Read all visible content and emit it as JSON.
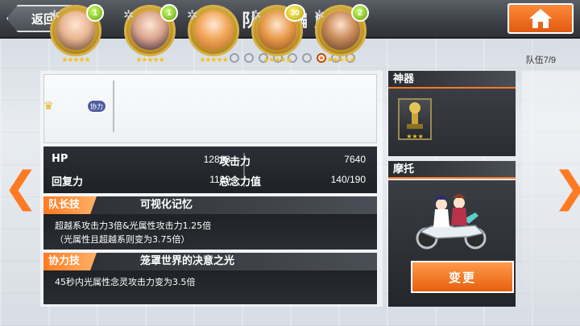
{
  "header": {
    "back_label": "返回",
    "title": "队伍编成"
  },
  "pager": {
    "team_count": "队伍7/9",
    "dots": 9,
    "active_index": 7
  },
  "characters": [
    {
      "level": "1",
      "stars": "★★★★★"
    },
    {
      "level": "1",
      "stars": "★★★★★"
    },
    {
      "level": "",
      "stars": "★★★★★"
    },
    {
      "level": "30",
      "stars": "★★★★★"
    },
    {
      "level": "2",
      "stars": "★★★★★"
    }
  ],
  "assist_tag": "协力",
  "stats": {
    "hp_label": "HP",
    "hp_value": "12828",
    "attack_label": "攻击力",
    "attack_value": "7640",
    "recovery_label": "回复力",
    "recovery_value": "1189",
    "total_label": "总念力值",
    "total_value": "140/190"
  },
  "leader_skill": {
    "tag": "队长技",
    "name": "可视化记忆",
    "line1": "超越系攻击力3倍&光属性攻击力1.25倍",
    "line2": "（光属性且超越系则变为3.75倍）"
  },
  "assist_skill": {
    "tag": "协力技",
    "name": "笼罩世界的决意之光",
    "line1": "45秒内光属性念灵攻击力变为3.5倍"
  },
  "relic": {
    "title": "神器",
    "stars": "★★★"
  },
  "bike": {
    "title": "摩托",
    "change_label": "变更"
  },
  "colors": {
    "accent": "#ff7a22",
    "level_green": "#6aa10f"
  }
}
